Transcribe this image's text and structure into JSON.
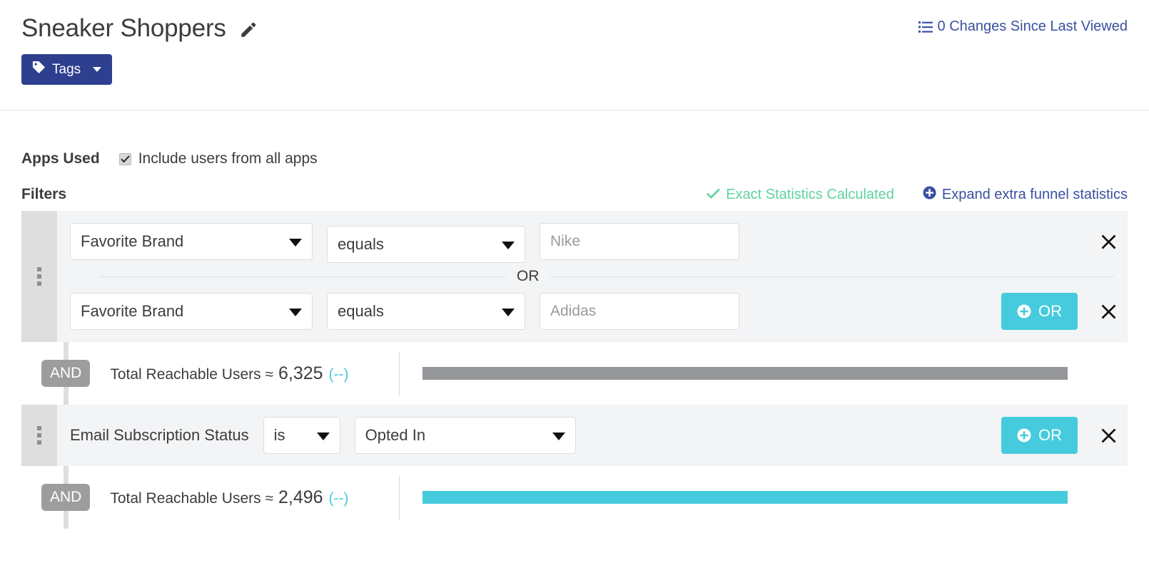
{
  "header": {
    "title": "Sneaker Shoppers",
    "edit_icon": "pencil-icon",
    "changes_label": "0 Changes Since Last Viewed",
    "changes_icon": "list-icon",
    "tags_label": "Tags",
    "tags_icon": "tag-icon",
    "tags_caret": "chevron-down-icon"
  },
  "apps_used": {
    "label": "Apps Used",
    "checkbox_label": "Include users from all apps",
    "checked": true
  },
  "filters": {
    "title": "Filters",
    "stats_calculated_label": "Exact Statistics Calculated",
    "stats_calculated_icon": "check-icon",
    "expand_label": "Expand extra funnel statistics",
    "expand_icon": "plus-circle-icon"
  },
  "groups": [
    {
      "conditions": [
        {
          "field": "Favorite Brand",
          "operator": "equals",
          "value": "Nike",
          "has_or_button": false,
          "remove_icon": "close-icon"
        },
        {
          "field": "Favorite Brand",
          "operator": "equals",
          "value": "Adidas",
          "has_or_button": true,
          "or_label": "OR",
          "remove_icon": "close-icon"
        }
      ],
      "joiner": "OR"
    },
    {
      "conditions": [
        {
          "field": "Email Subscription Status",
          "operator": "is",
          "value": "Opted In",
          "has_or_button": true,
          "or_label": "OR",
          "remove_icon": "close-icon"
        }
      ]
    }
  ],
  "stats_rows": [
    {
      "joiner": "AND",
      "label": "Total Reachable Users ≈",
      "value": "6,325",
      "delta": "(--)",
      "bar_color": "#949699",
      "bar_pct": 100
    },
    {
      "joiner": "AND",
      "label": "Total Reachable Users ≈",
      "value": "2,496",
      "delta": "(--)",
      "bar_color": "#45cbdd",
      "bar_pct": 100
    }
  ],
  "colors": {
    "brand_navy": "#2e3f8f",
    "link_blue": "#3b50a0",
    "teal": "#45cbdd",
    "green": "#5ed3a0",
    "gray_bar": "#949699",
    "and_badge": "#9d9d9d",
    "group_bg": "#f3f4f6",
    "drag_bg": "#dededf"
  }
}
